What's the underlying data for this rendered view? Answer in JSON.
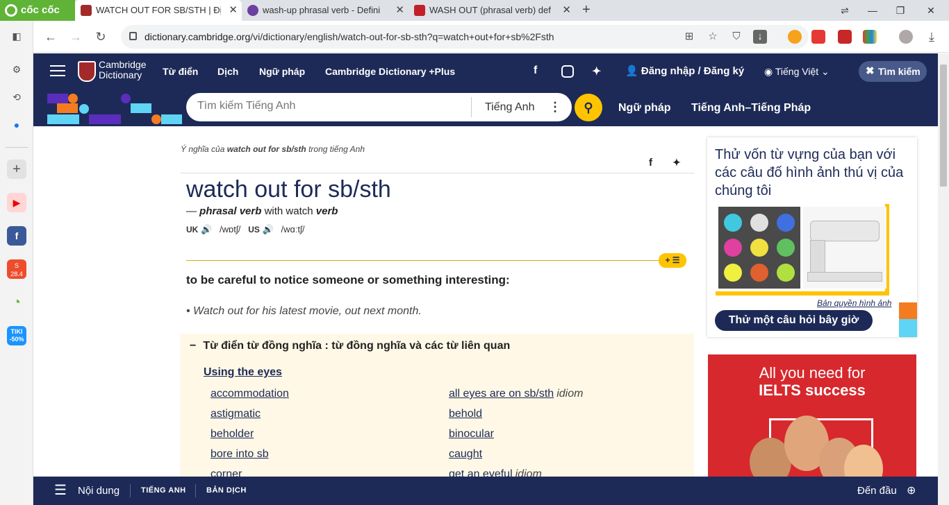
{
  "browser": {
    "brand": "cốc cốc",
    "tabs": [
      {
        "title": "WATCH OUT FOR SB/STH | Đị",
        "active": true,
        "icon": "cambridge-icon"
      },
      {
        "title": "wash-up phrasal verb - Defini",
        "active": false,
        "icon": "dictionary-icon"
      },
      {
        "title": "WASH OUT (phrasal verb) def",
        "active": false,
        "icon": "phrasal-icon"
      }
    ],
    "url_host": "dictionary.cambridge.org",
    "url_path": "/vi/dictionary/english/watch-out-for-sb-sth?q=watch+out+for+sb%2Fsth",
    "sidebar_badges": {
      "shopee": "28.4",
      "tiki": "TIKI",
      "tiki_discount": "-50%"
    }
  },
  "header": {
    "logo_line1": "Cambridge",
    "logo_line2": "Dictionary",
    "nav": [
      "Từ điển",
      "Dịch",
      "Ngữ pháp",
      "Cambridge Dictionary +Plus"
    ],
    "login": "Đăng nhập / Đăng ký",
    "language": "Tiếng Việt",
    "search_button": "Tìm kiếm"
  },
  "searchbar": {
    "placeholder": "Tìm kiếm Tiếng Anh",
    "dictionary": "Tiếng Anh",
    "links": [
      "Ngữ pháp",
      "Tiếng Anh–Tiếng Pháp"
    ]
  },
  "entry": {
    "crumb_prefix": "Ý nghĩa của",
    "crumb_term": "watch out for sb/sth",
    "crumb_suffix": "trong tiếng Anh",
    "headword": "watch out for sb/sth",
    "pos_prefix": "—",
    "pos": "phrasal verb",
    "pos_with": "with watch",
    "pos_verb": "verb",
    "uk_label": "UK",
    "uk_ipa": "/wɒtʃ/",
    "us_label": "US",
    "us_ipa": "/wɑːtʃ/",
    "definition": "to be careful to notice someone or something interesting:",
    "example": "• Watch out for his latest movie, out next month."
  },
  "synonyms": {
    "heading": "Từ điển từ đồng nghĩa : từ đồng nghĩa và các từ liên quan",
    "category": "Using the eyes",
    "left": [
      {
        "word": "accommodation",
        "tag": ""
      },
      {
        "word": "astigmatic",
        "tag": ""
      },
      {
        "word": "beholder",
        "tag": ""
      },
      {
        "word": "bore into sb",
        "tag": ""
      },
      {
        "word": "corner",
        "tag": ""
      }
    ],
    "right": [
      {
        "word": "all eyes are on sb/sth",
        "tag": "idiom"
      },
      {
        "word": "behold",
        "tag": ""
      },
      {
        "word": "binocular",
        "tag": ""
      },
      {
        "word": "caught",
        "tag": ""
      },
      {
        "word": "get an eyeful",
        "tag": "idiom"
      }
    ]
  },
  "quiz": {
    "title": "Thử vốn từ vựng của bạn với các câu đố hình ảnh thú vị của chúng tôi",
    "credit": "Bản quyền hình ảnh",
    "button": "Thử một câu hỏi bây giờ"
  },
  "ad": {
    "line1": "All you need for",
    "line2": "IELTS success"
  },
  "bottom": {
    "menu": "Nội dung",
    "tab1": "TIẾNG ANH",
    "tab2": "BẢN DỊCH",
    "top": "Đến đầu"
  },
  "colors": {
    "brand_navy": "#1d2a57",
    "accent_yellow": "#fec400",
    "coccoc_green": "#5fb336"
  }
}
